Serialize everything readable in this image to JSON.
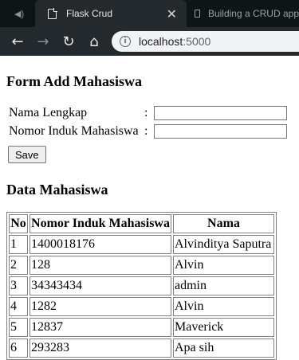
{
  "browser": {
    "tabs": [
      {
        "label": "",
        "icon": "speaker-icon"
      },
      {
        "label": "Flask Crud",
        "icon": "page-icon",
        "close": "✕"
      },
      {
        "label": "Building a CRUD app",
        "icon": "article-icon"
      }
    ],
    "url_host": "localhost",
    "url_port": ":5000"
  },
  "form": {
    "heading": "Form Add Mahasiswa",
    "name_label": "Nama Lengkap",
    "nim_label": "Nomor Induk Mahasiswa",
    "colon": ":",
    "name_value": "",
    "nim_value": "",
    "save_label": "Save"
  },
  "data": {
    "heading": "Data Mahasiswa",
    "columns": [
      "No",
      "Nomor Induk Mahasiswa",
      "Nama"
    ],
    "rows": [
      [
        "1",
        "1400018176",
        "Alvinditya Saputra"
      ],
      [
        "2",
        "128",
        "Alvin"
      ],
      [
        "3",
        "34343434",
        "admin"
      ],
      [
        "4",
        "1282",
        "Alvin"
      ],
      [
        "5",
        "12837",
        "Maverick"
      ],
      [
        "6",
        "293283",
        "Apa sih"
      ]
    ]
  }
}
